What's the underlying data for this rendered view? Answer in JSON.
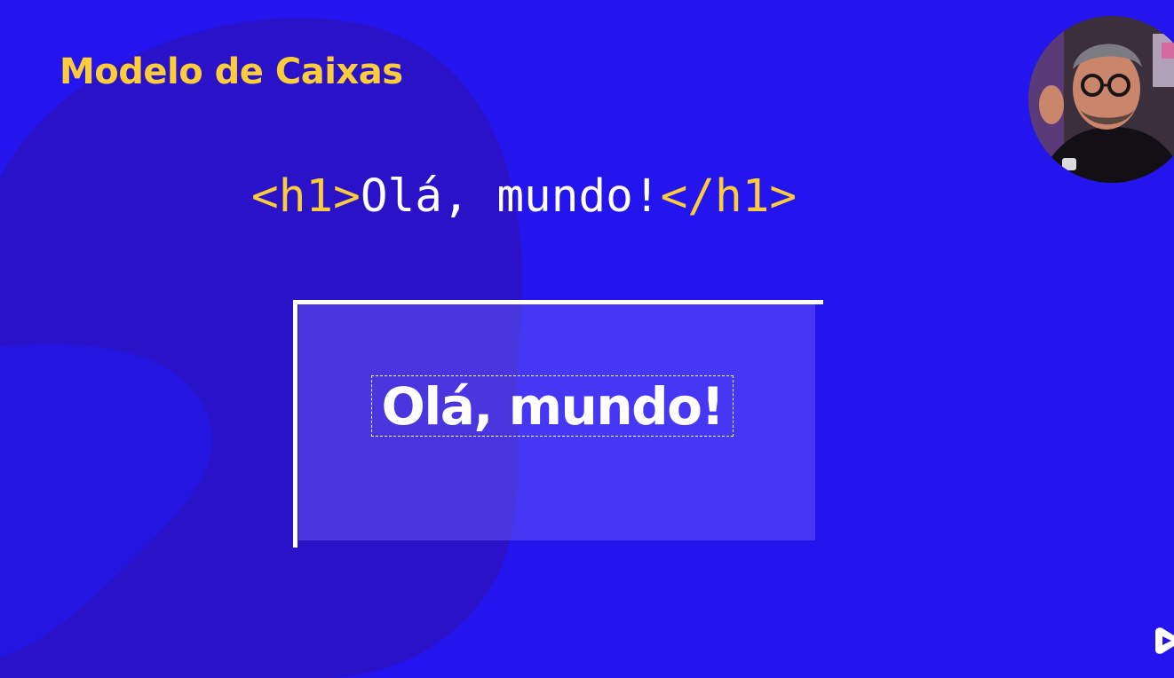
{
  "slide": {
    "title": "Modelo de Caixas",
    "code": {
      "open_tag": "<h1>",
      "content": "Olá, mundo!",
      "close_tag": "</h1>"
    },
    "rendered_heading": "Olá, mundo!"
  },
  "colors": {
    "background": "#2414ee",
    "blob": "#2a12c8",
    "accent_yellow": "#fccc3a",
    "text_white": "#ffffff"
  },
  "icons": {
    "presenter": "presenter-webcam",
    "brand": "play-logo-icon"
  }
}
